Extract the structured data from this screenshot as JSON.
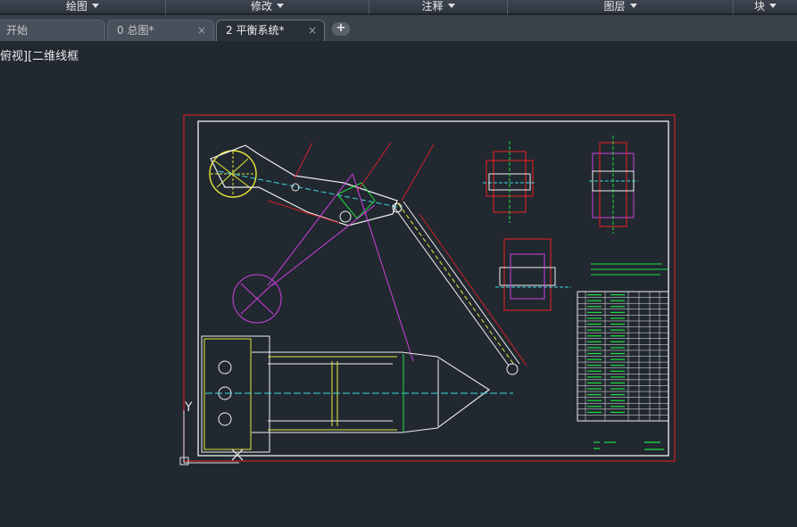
{
  "ribbon": {
    "panels": [
      {
        "label": "绘图"
      },
      {
        "label": "修改"
      },
      {
        "label": "注释"
      },
      {
        "label": "图层"
      },
      {
        "label": "块"
      }
    ]
  },
  "tabs": [
    {
      "label": "开始"
    },
    {
      "label": "0 总图*"
    },
    {
      "label": "2 平衡系统*"
    }
  ],
  "tab_close_glyph": "×",
  "new_tab_glyph": "+",
  "viewport": {
    "view_label": "俯视][二维线框",
    "ucs_y_label": "Y"
  },
  "colors": {
    "background": "#212830",
    "frame_red": "#d0202a",
    "line_white": "#f0f0f0",
    "line_yellow": "#e8e83a",
    "line_cyan": "#40d8e0",
    "line_magenta": "#d040e0",
    "line_green": "#20e040",
    "line_red": "#f02020"
  }
}
